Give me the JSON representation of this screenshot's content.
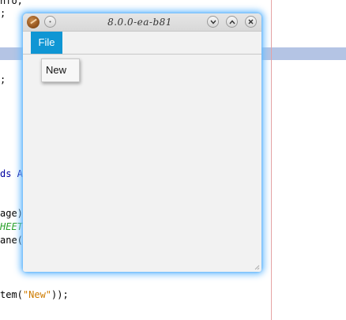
{
  "editor": {
    "lines": [
      {
        "id": "l1",
        "parts": [
          {
            "t": "nfo;",
            "c": ""
          }
        ]
      },
      {
        "id": "l2",
        "parts": [
          {
            "t": ";",
            "c": ""
          }
        ]
      },
      {
        "id": "l3",
        "parts": [
          {
            "t": ";",
            "c": ""
          }
        ]
      },
      {
        "id": "l4",
        "parts": [
          {
            "t": "ds A",
            "c": "kw"
          }
        ]
      },
      {
        "id": "l5",
        "parts": [
          {
            "t": "age)",
            "c": ""
          }
        ]
      },
      {
        "id": "l6",
        "parts": [
          {
            "t": "HEET",
            "c": "cn"
          }
        ]
      },
      {
        "id": "l7",
        "parts": [
          {
            "t": "ane(",
            "c": ""
          }
        ]
      },
      {
        "id": "l8",
        "parts": [
          {
            "t": "tem(",
            "c": ""
          },
          {
            "t": "\"New\"",
            "c": "st"
          },
          {
            "t": "));",
            "c": ""
          }
        ]
      }
    ],
    "colors": {
      "keyword": "#0000a0",
      "constant": "#2aa12a",
      "string": "#ce7b00",
      "highlight_band": "#b4c4e4",
      "margin_line": "#e6a3a3"
    }
  },
  "window": {
    "title": "8.0.0-ea-b81",
    "app_icon": "java-app-icon",
    "titlebar_buttons": {
      "pin": "pin-icon",
      "minimize": "chevron-down-icon",
      "maximize": "chevron-up-icon",
      "close": "close-icon"
    },
    "glow_color": "#6ebeff"
  },
  "menubar": {
    "items": [
      {
        "label": "File",
        "active": true
      }
    ],
    "active_color": "#0f96d4"
  },
  "file_menu": {
    "items": [
      {
        "label": "New"
      }
    ]
  }
}
